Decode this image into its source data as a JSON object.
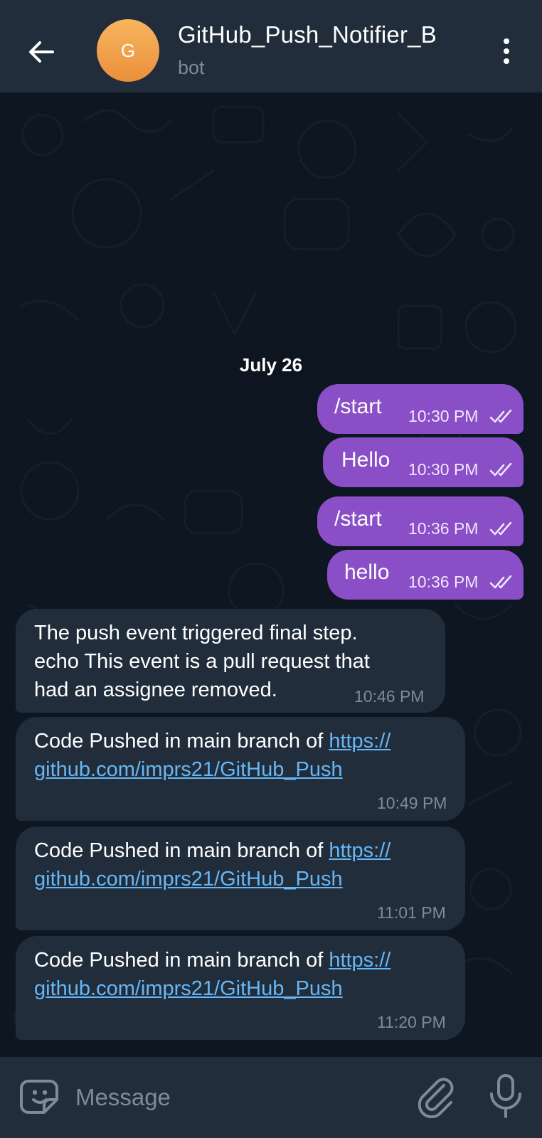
{
  "header": {
    "avatar_letter": "G",
    "title": "GitHub_Push_Notifier_B",
    "subtitle": "bot"
  },
  "chat": {
    "date_chip": "July 26",
    "outgoing": [
      {
        "text": "/start",
        "time": "10:30 PM"
      },
      {
        "text": "Hello",
        "time": "10:30 PM"
      },
      {
        "text": "/start",
        "time": "10:36 PM"
      },
      {
        "text": "hello",
        "time": "10:36 PM"
      }
    ],
    "incoming": [
      {
        "lines": [
          "The push event triggered final step.",
          "echo This event is a pull request that",
          "had an assignee removed."
        ],
        "time": "10:46 PM"
      },
      {
        "text": "Code Pushed in main branch of ",
        "link_line1": "https://",
        "link_line2": "github.com/imprs21/GitHub_Push",
        "time": "10:49 PM"
      },
      {
        "text": "Code Pushed in main branch of ",
        "link_line1": "https://",
        "link_line2": "github.com/imprs21/GitHub_Push",
        "time": "11:01 PM"
      },
      {
        "text": "Code Pushed in main branch of ",
        "link_line1": "https://",
        "link_line2": "github.com/imprs21/GitHub_Push",
        "time": "11:20 PM"
      }
    ]
  },
  "input": {
    "placeholder": "Message"
  },
  "colors": {
    "header_bg": "#212d3b",
    "chat_bg": "#0e1621",
    "outgoing_bubble": "#8a4fc7",
    "incoming_bubble": "#212d3b",
    "link": "#67b6f5",
    "muted_text": "#7d8b99"
  },
  "icons": {
    "back": "arrow-left-icon",
    "menu": "more-vertical-icon",
    "read_status": "double-check-icon",
    "emoji": "sticker-icon",
    "attach": "paperclip-icon",
    "mic": "microphone-icon"
  }
}
